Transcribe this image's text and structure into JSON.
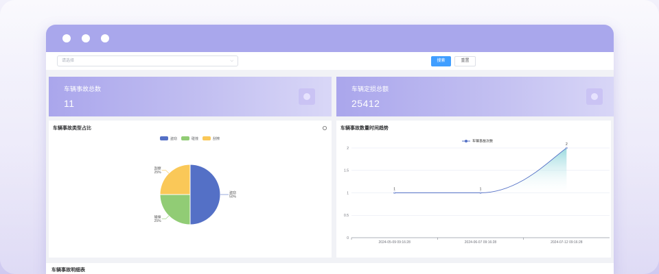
{
  "filter": {
    "select_placeholder": "请选择",
    "search_label": "搜索",
    "reset_label": "重置"
  },
  "stats": [
    {
      "label": "车辆事故总数",
      "value": "11"
    },
    {
      "label": "车辆定损总额",
      "value": "25412"
    }
  ],
  "pie_panel": {
    "title": "车辆事故类型占比"
  },
  "line_panel": {
    "title": "车辆事故数量时间趋势"
  },
  "table": {
    "title": "车辆事故明细表"
  },
  "icons": [
    "window-dot-icon",
    "chevron-down-icon",
    "stat-icon",
    "refresh-icon"
  ],
  "chart_data": [
    {
      "type": "pie",
      "categories": [
        "盗窃",
        "碰撞",
        "刮擦"
      ],
      "values": [
        50,
        25,
        25
      ],
      "labels": [
        "盗窃\n50%",
        "碰撞\n25%",
        "刮擦\n25%"
      ],
      "colors": [
        "#5470c6",
        "#91cc75",
        "#fac858"
      ],
      "legend": "top-center"
    },
    {
      "type": "area",
      "x": [
        "2024-05-09 09:16:28",
        "2024-06-07 09:16:28",
        "2024-07-12 09:16:28"
      ],
      "series": [
        {
          "name": "车辆事故次数",
          "values": [
            1,
            1,
            2
          ]
        }
      ],
      "ylim": [
        0,
        2
      ],
      "yticks": [
        "0",
        "0.5",
        "1",
        "1.5",
        "2"
      ],
      "grid": true,
      "legend": "top-center"
    }
  ]
}
